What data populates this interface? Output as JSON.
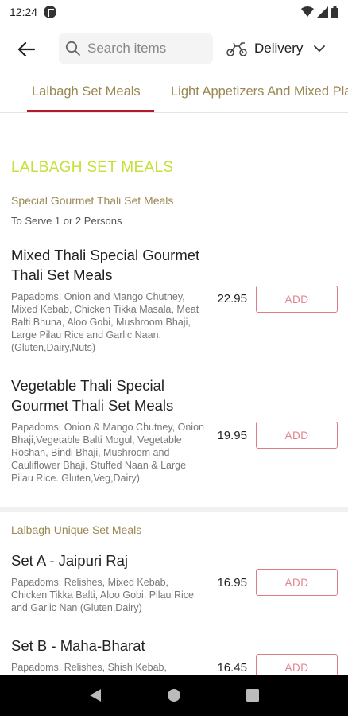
{
  "status": {
    "time": "12:24"
  },
  "search": {
    "placeholder": "Search items"
  },
  "order_mode": {
    "label": "Delivery"
  },
  "tabs": [
    {
      "label": "Lalbagh Set Meals"
    },
    {
      "label": "Light Appetizers And Mixed Platters"
    }
  ],
  "menu": {
    "section_title": "LALBAGH SET MEALS",
    "groups": [
      {
        "title": "Special Gourmet Thali Set Meals",
        "subtitle": "To Serve 1 or 2 Persons",
        "items": [
          {
            "name": "Mixed Thali Special Gourmet Thali Set Meals",
            "description": "Papadoms, Onion and Mango Chutney, Mixed Kebab, Chicken Tikka Masala, Meat Balti Bhuna, Aloo Gobi, Mushroom Bhaji, Large Pilau Rice and Garlic Naan.(Gluten,Dairy,Nuts)",
            "price": "22.95",
            "add_label": "ADD"
          },
          {
            "name": "Vegetable Thali Special Gourmet Thali Set Meals",
            "description": "Papadoms, Onion & Mango Chutney, Onion Bhaji,Vegetable Balti Mogul, Vegetable Roshan, Bindi Bhaji, Mushroom and Cauliflower Bhaji, Stuffed Naan & Large Pilau Rice. Gluten,Veg,Dairy)",
            "price": "19.95",
            "add_label": "ADD"
          }
        ]
      },
      {
        "title": "Lalbagh Unique Set Meals",
        "items": [
          {
            "name": "Set A - Jaipuri Raj",
            "description": "Papadoms, Relishes, Mixed Kebab, Chicken Tikka Balti, Aloo Gobi, Pilau Rice and Garlic Nan (Gluten,Dairy)",
            "price": "16.95",
            "add_label": "ADD"
          },
          {
            "name": "Set B - Maha-Bharat",
            "description": "Papadoms, Relishes, Shish Kebab,",
            "price": "16.45",
            "add_label": "ADD"
          }
        ]
      }
    ]
  },
  "colors": {
    "accent": "#b5192e",
    "section_title": "#c6e03a",
    "gold": "#9a8752",
    "add_border": "#e07a86"
  }
}
